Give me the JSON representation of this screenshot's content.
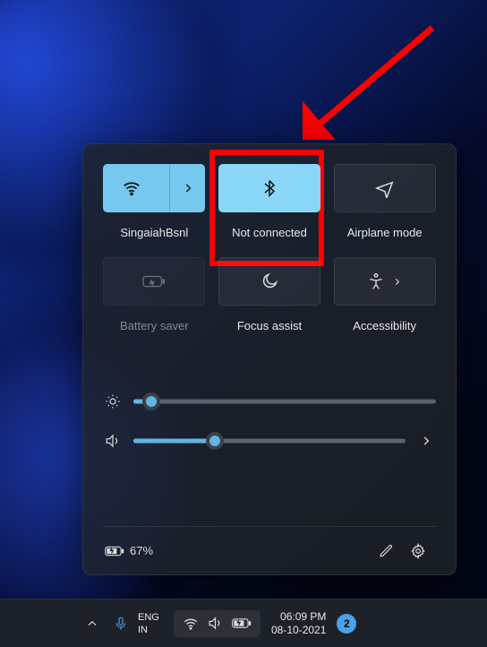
{
  "wifi": {
    "label": "SingaiahBsnl"
  },
  "bluetooth": {
    "label": "Not connected"
  },
  "airplane": {
    "label": "Airplane mode"
  },
  "battery_saver": {
    "label": "Battery saver"
  },
  "focus_assist": {
    "label": "Focus assist"
  },
  "accessibility": {
    "label": "Accessibility"
  },
  "sliders": {
    "brightness_pct": 6,
    "volume_pct": 30
  },
  "footer": {
    "battery_pct": "67%"
  },
  "taskbar": {
    "lang_line1": "ENG",
    "lang_line2": "IN",
    "time": "06:09 PM",
    "date": "08-10-2021",
    "notif_count": "2"
  }
}
